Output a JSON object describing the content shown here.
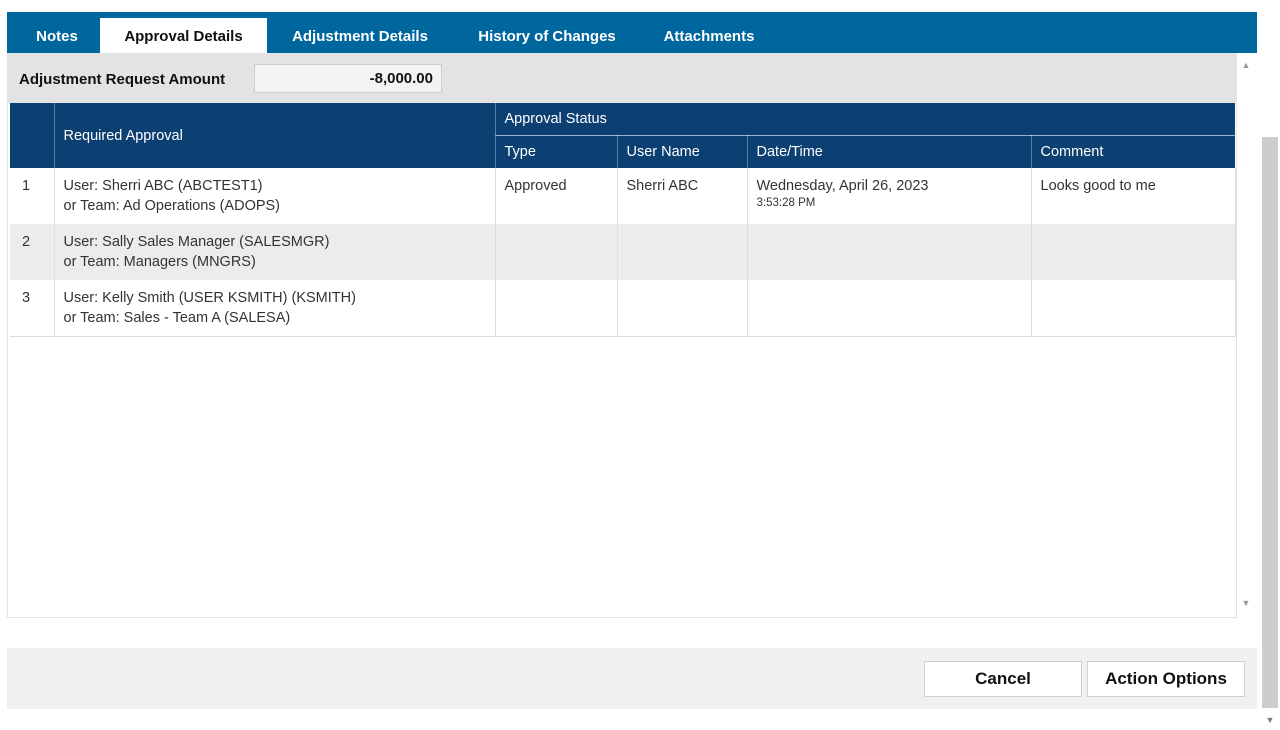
{
  "tabs": {
    "notes": "Notes",
    "approval_details": "Approval Details",
    "adjustment_details": "Adjustment Details",
    "history": "History of Changes",
    "attachments": "Attachments",
    "active": "approval_details"
  },
  "amount": {
    "label": "Adjustment Request Amount",
    "value": "-8,000.00"
  },
  "table": {
    "headers": {
      "required_approval": "Required Approval",
      "approval_status": "Approval Status",
      "type": "Type",
      "user_name": "User Name",
      "date_time": "Date/Time",
      "comment": "Comment"
    },
    "rows": [
      {
        "num": "1",
        "user": "User: Sherri ABC (ABCTEST1)",
        "team": "or Team: Ad Operations (ADOPS)",
        "type": "Approved",
        "user_name": "Sherri ABC",
        "date": "Wednesday, April 26, 2023",
        "time": "3:53:28 PM",
        "comment": "Looks good to me"
      },
      {
        "num": "2",
        "user": "User: Sally Sales Manager (SALESMGR)",
        "team": "or Team: Managers (MNGRS)",
        "type": "",
        "user_name": "",
        "date": "",
        "time": "",
        "comment": ""
      },
      {
        "num": "3",
        "user": "User: Kelly Smith (USER KSMITH) (KSMITH)",
        "team": "or Team: Sales - Team A (SALESA)",
        "type": "",
        "user_name": "",
        "date": "",
        "time": "",
        "comment": ""
      }
    ]
  },
  "footer": {
    "cancel": "Cancel",
    "action_options": "Action Options"
  }
}
